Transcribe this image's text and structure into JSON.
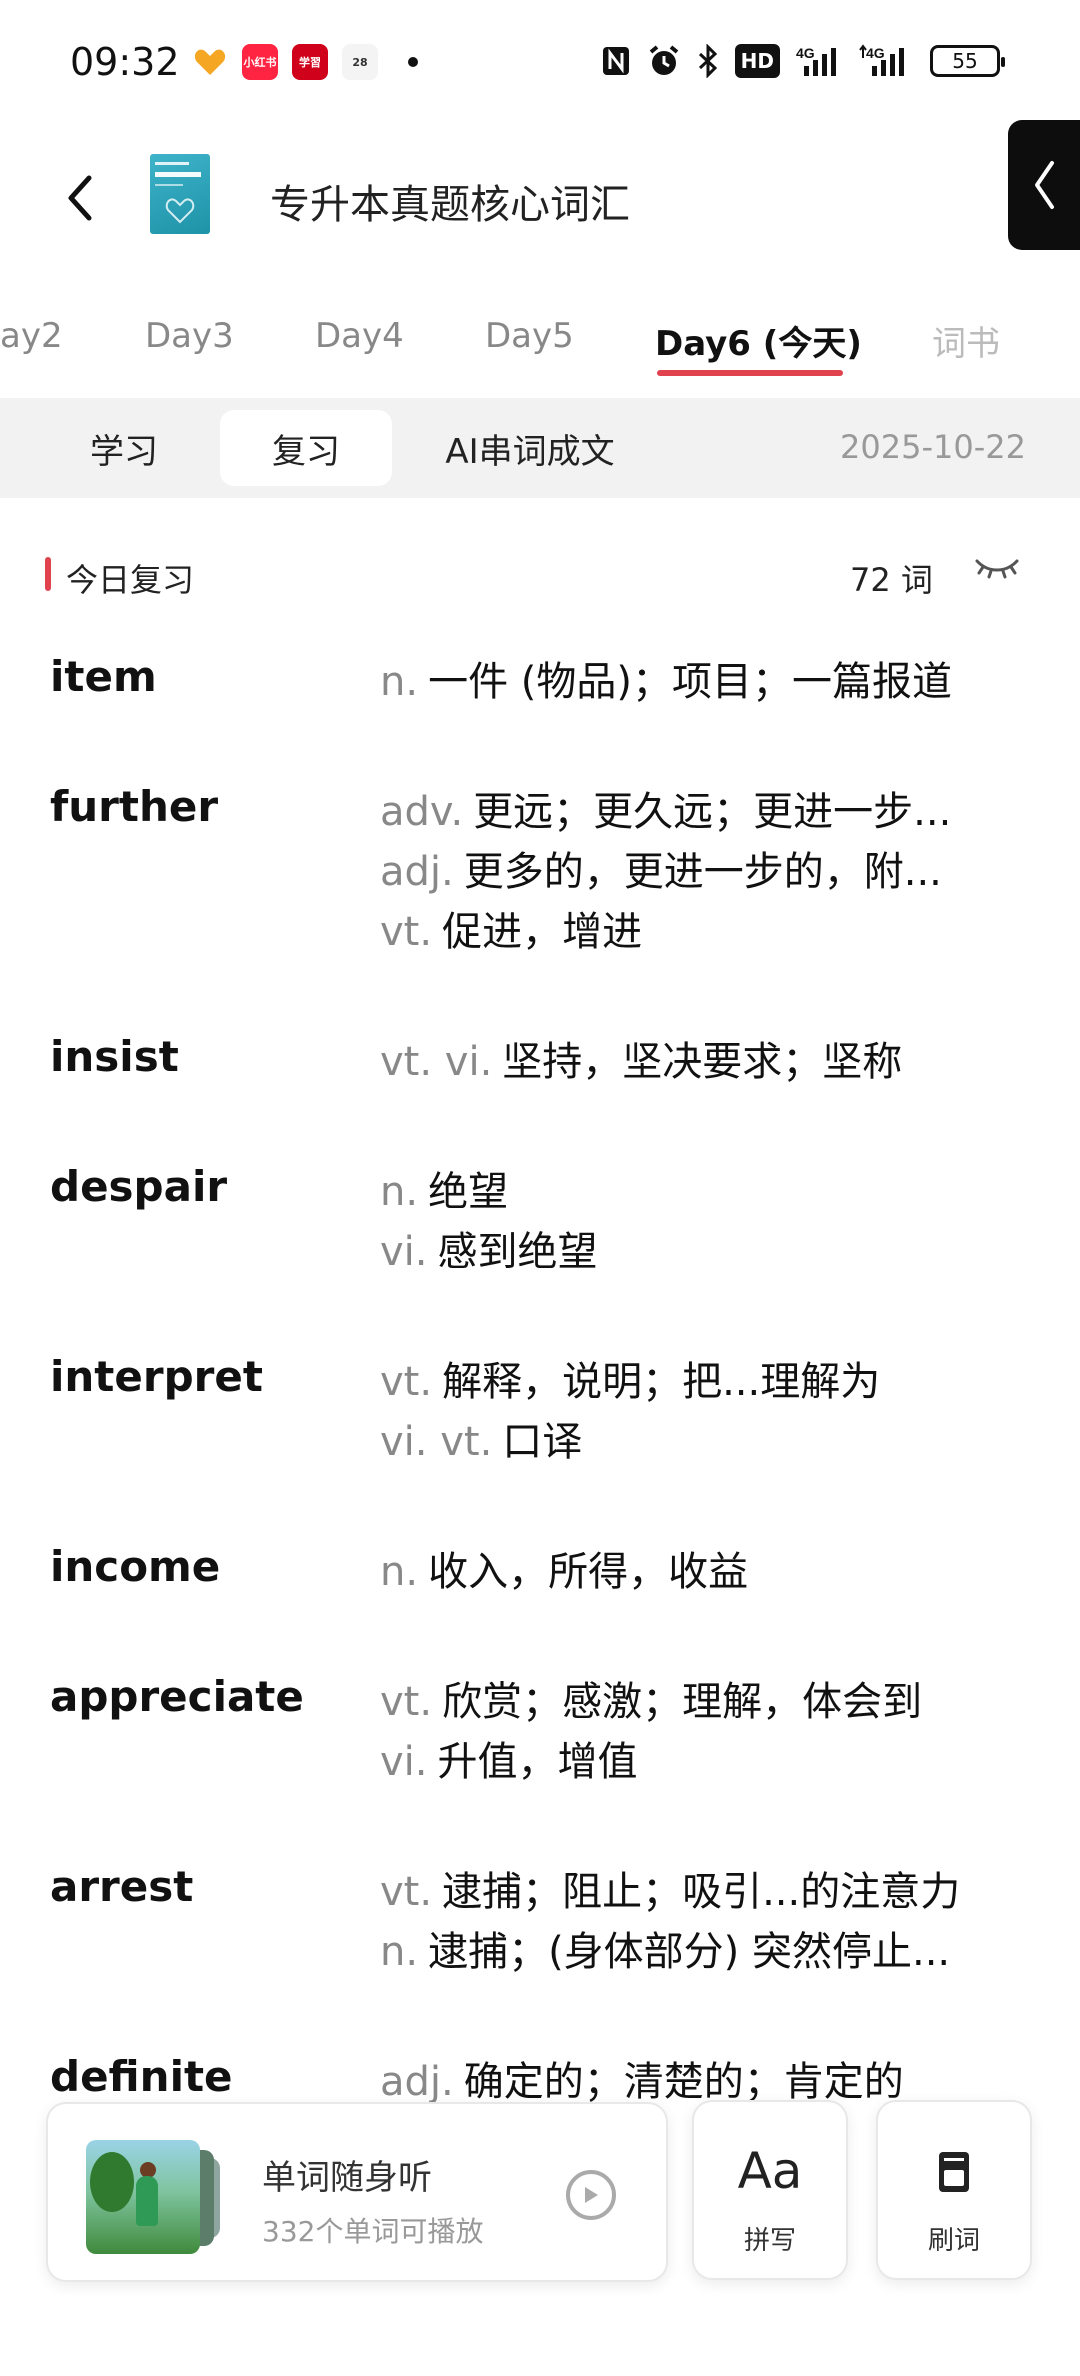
{
  "status_bar": {
    "time": "09:32",
    "apps": [
      {
        "icon": "heart-app-icon",
        "color": "#f5a623"
      },
      {
        "icon": "xiaohongshu-app-icon",
        "label": "小红书",
        "color": "#ff2442"
      },
      {
        "icon": "xuexi-app-icon",
        "label": "学習",
        "color": "#d0021b"
      },
      {
        "icon": "calendar-app-icon",
        "label": "28",
        "color": "#f4f4f4"
      }
    ],
    "icons": [
      "nfc-icon",
      "alarm-icon",
      "bluetooth-icon",
      "hd-icon",
      "signal-4g-icon",
      "signal-4g-icon-2"
    ],
    "hd_label": "HD",
    "net1": "4G",
    "net2": "4G",
    "battery": "55"
  },
  "header": {
    "title": "专升本真题核心词汇"
  },
  "day_tabs": [
    {
      "label": "ay2"
    },
    {
      "label": "Day3"
    },
    {
      "label": "Day4"
    },
    {
      "label": "Day5"
    },
    {
      "label": "Day6 (今天)",
      "active": true
    },
    {
      "label": "词书"
    }
  ],
  "modes": {
    "study": "学习",
    "review": "复习",
    "ai": "AI串词成文",
    "date": "2025-10-22"
  },
  "section": {
    "title": "今日复习",
    "count": "72 词"
  },
  "words": [
    {
      "term": "item",
      "defs": [
        {
          "pos": "n.",
          "text": "一件 (物品)；项目；一篇报道"
        }
      ]
    },
    {
      "term": "further",
      "defs": [
        {
          "pos": "adv.",
          "text": "更远；更久远；更进一步..."
        },
        {
          "pos": "adj.",
          "text": "更多的，更进一步的，附..."
        },
        {
          "pos": "vt.",
          "text": "促进，增进"
        }
      ]
    },
    {
      "term": "insist",
      "defs": [
        {
          "pos": "vt.  vi.",
          "text": "坚持，坚决要求；坚称"
        }
      ]
    },
    {
      "term": "despair",
      "defs": [
        {
          "pos": "n.",
          "text": "绝望"
        },
        {
          "pos": "vi.",
          "text": "感到绝望"
        }
      ]
    },
    {
      "term": "interpret",
      "defs": [
        {
          "pos": "vt.",
          "text": "解释，说明；把...理解为"
        },
        {
          "pos": "vi.  vt.",
          "text": "口译"
        }
      ]
    },
    {
      "term": "income",
      "defs": [
        {
          "pos": "n.",
          "text": "收入，所得，收益"
        }
      ]
    },
    {
      "term": "appreciate",
      "defs": [
        {
          "pos": "vt.",
          "text": "欣赏；感激；理解，体会到"
        },
        {
          "pos": "vi.",
          "text": "升值，增值"
        }
      ]
    },
    {
      "term": "arrest",
      "defs": [
        {
          "pos": "vt.",
          "text": "逮捕；阻止；吸引...的注意力"
        },
        {
          "pos": "n.",
          "text": "逮捕；(身体部分) 突然停止..."
        }
      ]
    },
    {
      "term": "definite",
      "defs": [
        {
          "pos": "adj.",
          "text": "确定的；清楚的；肯定的"
        }
      ]
    }
  ],
  "bottom": {
    "listen_title": "单词随身听",
    "listen_sub": "332个单词可播放",
    "spell_glyph": "Aa",
    "spell_label": "拼写",
    "brush_label": "刷词"
  }
}
